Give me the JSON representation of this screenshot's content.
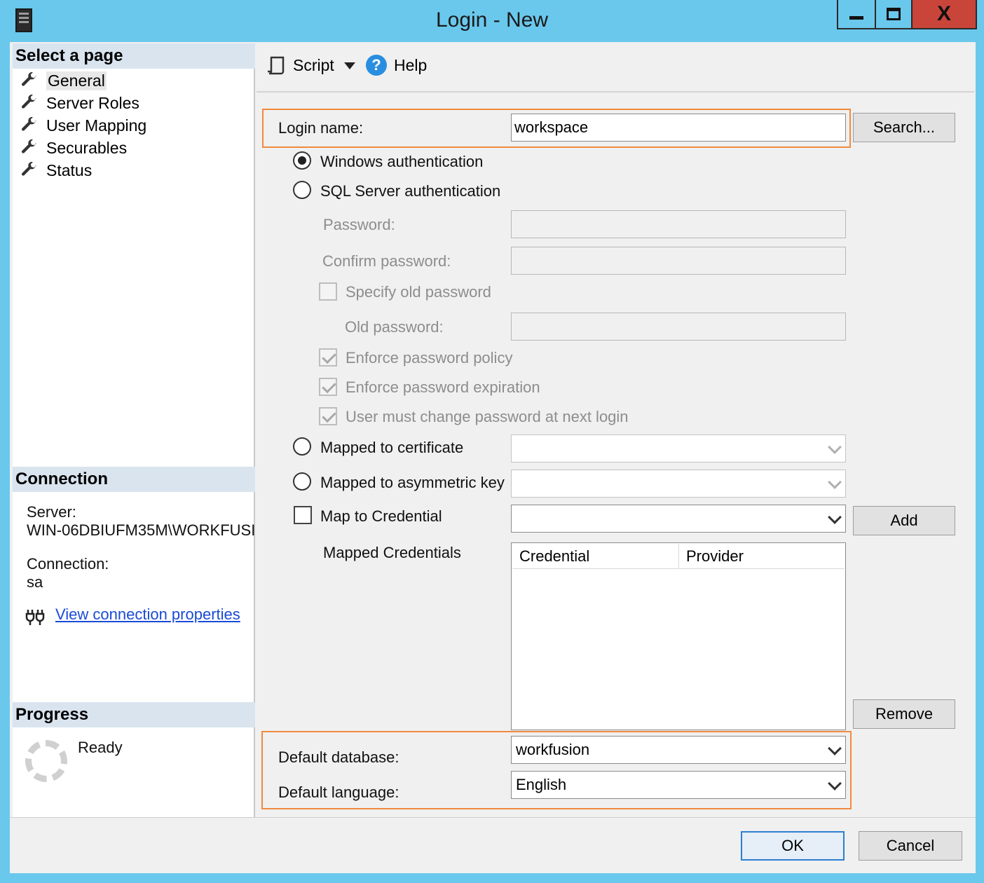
{
  "window": {
    "title": "Login - New",
    "close_glyph": "X"
  },
  "sidebar": {
    "select_page_header": "Select a page",
    "items": [
      {
        "label": "General",
        "icon": "wrench-icon"
      },
      {
        "label": "Server Roles",
        "icon": "wrench-icon"
      },
      {
        "label": "User Mapping",
        "icon": "wrench-icon"
      },
      {
        "label": "Securables",
        "icon": "wrench-icon"
      },
      {
        "label": "Status",
        "icon": "wrench-icon"
      }
    ],
    "connection_header": "Connection",
    "server_label": "Server:",
    "server_value": "WIN-06DBIUFM35M\\WORKFUSI",
    "connection_label": "Connection:",
    "connection_value": "sa",
    "view_props_link": "View connection properties",
    "progress_header": "Progress",
    "progress_status": "Ready"
  },
  "toolbar": {
    "script_label": "Script",
    "help_label": "Help"
  },
  "form": {
    "login_name_label": "Login name:",
    "login_name_value": "workspace",
    "search_button": "Search...",
    "windows_auth": "Windows authentication",
    "sql_auth": "SQL Server authentication",
    "password_label": "Password:",
    "confirm_password_label": "Confirm password:",
    "specify_old_password": "Specify old password",
    "old_password_label": "Old password:",
    "enforce_policy": "Enforce password policy",
    "enforce_expiration": "Enforce password expiration",
    "must_change": "User must change password at next login",
    "mapped_certificate": "Mapped to certificate",
    "mapped_asym_key": "Mapped to asymmetric key",
    "map_credential": "Map to Credential",
    "add_button": "Add",
    "mapped_credentials_label": "Mapped Credentials",
    "grid_columns": [
      "Credential",
      "Provider"
    ],
    "remove_button": "Remove",
    "default_database_label": "Default database:",
    "default_database_value": "workfusion",
    "default_language_label": "Default language:",
    "default_language_value": "English"
  },
  "footer": {
    "ok_button": "OK",
    "cancel_button": "Cancel"
  },
  "colors": {
    "titlebar": "#6ac8ec",
    "close_button": "#c9453a",
    "highlight": "#f08a3e",
    "link": "#1a4bd6",
    "section_header": "#d9e4ef"
  }
}
